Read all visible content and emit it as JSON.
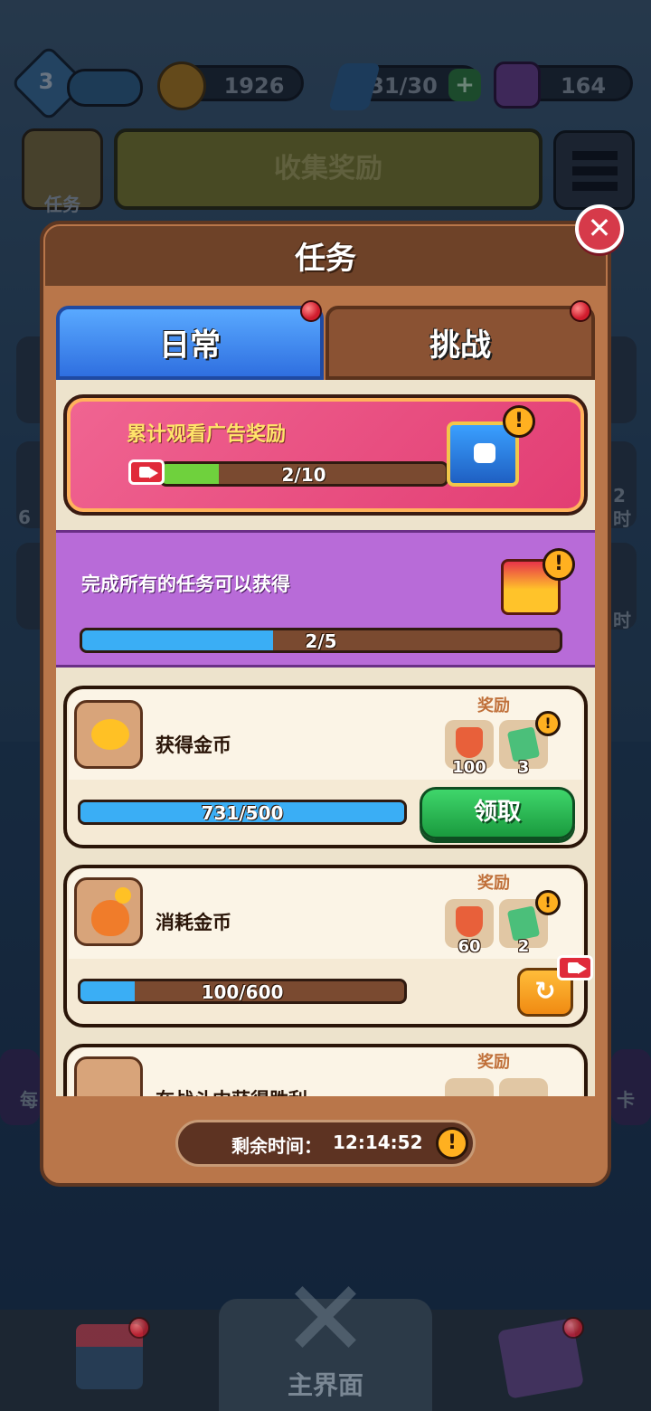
{
  "hud": {
    "level": "3",
    "coins": "1926",
    "energy": "31/30",
    "gems": "164"
  },
  "background": {
    "task_button_label": "任务",
    "collect_reward_label": "收集奖励",
    "side_left_labels": [
      "6",
      "每"
    ],
    "side_right_labels": [
      "2",
      "时",
      "时",
      "卡"
    ]
  },
  "panel": {
    "title": "任务",
    "tabs": {
      "daily": "日常",
      "challenge": "挑战"
    },
    "ad_reward": {
      "title": "累计观看广告奖励",
      "progress_text": "2/10",
      "progress": 0.2
    },
    "complete_all": {
      "text": "完成所有的任务可以获得",
      "progress_text": "2/5",
      "progress": 0.4
    },
    "tasks": [
      {
        "name": "获得金币",
        "reward_label": "奖励",
        "reward_1": "100",
        "reward_2": "3",
        "progress_text": "731/500",
        "progress": 1.0,
        "action": "领取"
      },
      {
        "name": "消耗金币",
        "reward_label": "奖励",
        "reward_1": "60",
        "reward_2": "2",
        "progress_text": "100/600",
        "progress": 0.1667,
        "action": "↻"
      },
      {
        "name": "在战斗中获得胜利",
        "reward_label": "奖励"
      }
    ],
    "timer": {
      "label": "剩余时间：",
      "value": "12:14:52"
    }
  },
  "nav": {
    "center_label": "主界面"
  },
  "colors": {
    "blue_fill": "#3aaef5",
    "green_fill": "#6fd13d",
    "tab_active": "#3a85ee",
    "panel_wood": "#b9764a",
    "purple": "#b86bd8"
  }
}
